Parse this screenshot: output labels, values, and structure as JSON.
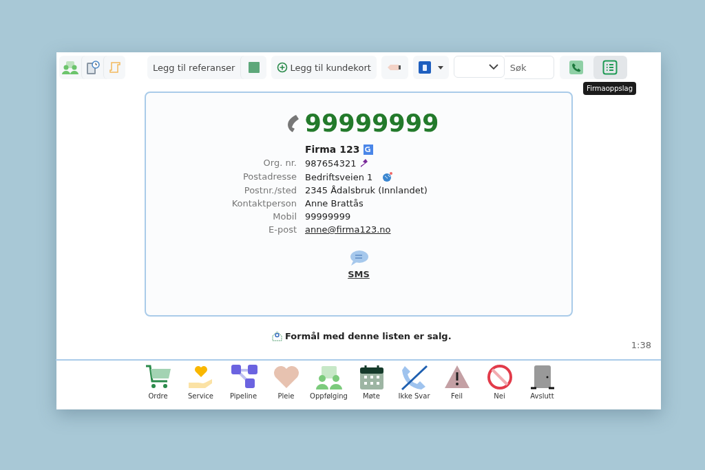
{
  "toolbar": {
    "reference_button": "Legg til referanser",
    "customer_card_button": "Legg til kundekort",
    "search": {
      "placeholder": "Søk"
    },
    "view_buttons": [
      {
        "kind": "phone",
        "selected": false
      },
      {
        "kind": "list",
        "selected": true
      }
    ],
    "tooltip": "Firmaoppslag"
  },
  "card": {
    "phone": "99999999",
    "company": "Firma 123",
    "fields": [
      {
        "label": "Org. nr.",
        "value": "987654321",
        "kind": "org"
      },
      {
        "label": "Postadresse",
        "value": "Bedriftsveien 1",
        "kind": "address"
      },
      {
        "label": "Postnr./sted",
        "value": "2345 Ådalsbruk (Innlandet)",
        "kind": "text"
      },
      {
        "label": "Kontaktperson",
        "value": "Anne Brattås",
        "kind": "text"
      },
      {
        "label": "Mobil",
        "value": "99999999",
        "kind": "text"
      },
      {
        "label": "E-post",
        "value": "anne@firma123.no",
        "kind": "email"
      }
    ],
    "sms": "SMS"
  },
  "purpose": "Formål med denne listen er salg.",
  "timer": "1:38",
  "actions": [
    {
      "label": "Ordre",
      "kind": "cart"
    },
    {
      "label": "Service",
      "kind": "service"
    },
    {
      "label": "Pipeline",
      "kind": "pipeline"
    },
    {
      "label": "Pleie",
      "kind": "heart"
    },
    {
      "label": "Oppfølging",
      "kind": "meeting"
    },
    {
      "label": "Møte",
      "kind": "calendar"
    },
    {
      "label": "Ikke Svar",
      "kind": "noanswer"
    },
    {
      "label": "Feil",
      "kind": "warning"
    },
    {
      "label": "Nei",
      "kind": "no"
    },
    {
      "label": "Avslutt",
      "kind": "exit"
    }
  ]
}
